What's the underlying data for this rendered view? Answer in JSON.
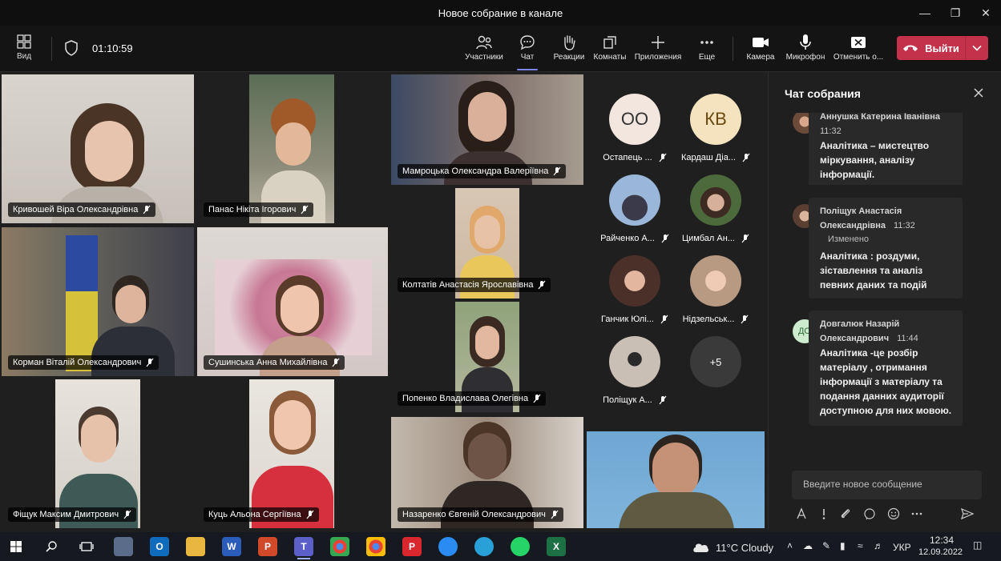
{
  "window": {
    "title": "Новое собрание в канале"
  },
  "toolbar": {
    "view_label": "Вид",
    "timer": "01:10:59",
    "buttons": {
      "participants": "Участники",
      "chat": "Чат",
      "reactions": "Реакции",
      "rooms": "Комнаты",
      "apps": "Приложения",
      "more": "Еще",
      "camera": "Камера",
      "mic": "Микрофон",
      "share": "Отменить о..."
    },
    "leave_label": "Выйти"
  },
  "videos": {
    "v1": "Кривошей Віра Олександрівна",
    "v2": "Панас Нікіта Ігорович",
    "v3": "Мамроцька Олександра Валеріївна",
    "v4": "Колтатів Анастасія Ярославівна",
    "v5": "Корман Віталій Олександрович",
    "v6": "Сушинська Анна Михайлівна",
    "v7": "Попенко Владислава Олегівна",
    "v8": "Фіщук Максим Дмитрович",
    "v9": "Куць Альона Сергіївна",
    "v10": "Назаренко Євгеній Олександрович"
  },
  "participants": {
    "p1": {
      "initials": "ОО",
      "name": "Остапець ..."
    },
    "p2": {
      "initials": "КВ",
      "name": "Кардаш Діа..."
    },
    "p3": {
      "name": "Райченко А..."
    },
    "p4": {
      "name": "Цимбал Ан..."
    },
    "p5": {
      "name": "Ганчик Юлі..."
    },
    "p6": {
      "name": "Нідзельськ..."
    },
    "p7": {
      "name": "Поліщук А..."
    },
    "more": "+5"
  },
  "chat": {
    "title": "Чат собрания",
    "messages": [
      {
        "author": "Аннушка Катерина Іванівна",
        "time": "11:32",
        "text": "Аналітика – мистецтво міркування, аналізу інформації."
      },
      {
        "author_line1": "Поліщук Анастасія",
        "author_line2": "Олександрівна",
        "time": "11:32",
        "edited": "Изменено",
        "text": "Аналітика : роздуми, зіставлення та аналіз певних даних та подій"
      },
      {
        "avatar": "ДО",
        "author_line1": "Довгалюк Назарій",
        "author_line2": "Олександрович",
        "time": "11:44",
        "text": "Аналітика -це розбір матеріалу , отримання інформації з матеріалу та подання данних аудиторії доступною для них мовою."
      }
    ],
    "compose_placeholder": "Введите новое сообщение"
  },
  "taskbar": {
    "weather": "11°C  Cloudy",
    "lang": "УКР",
    "time": "12:34",
    "date": "12.09.2022"
  }
}
